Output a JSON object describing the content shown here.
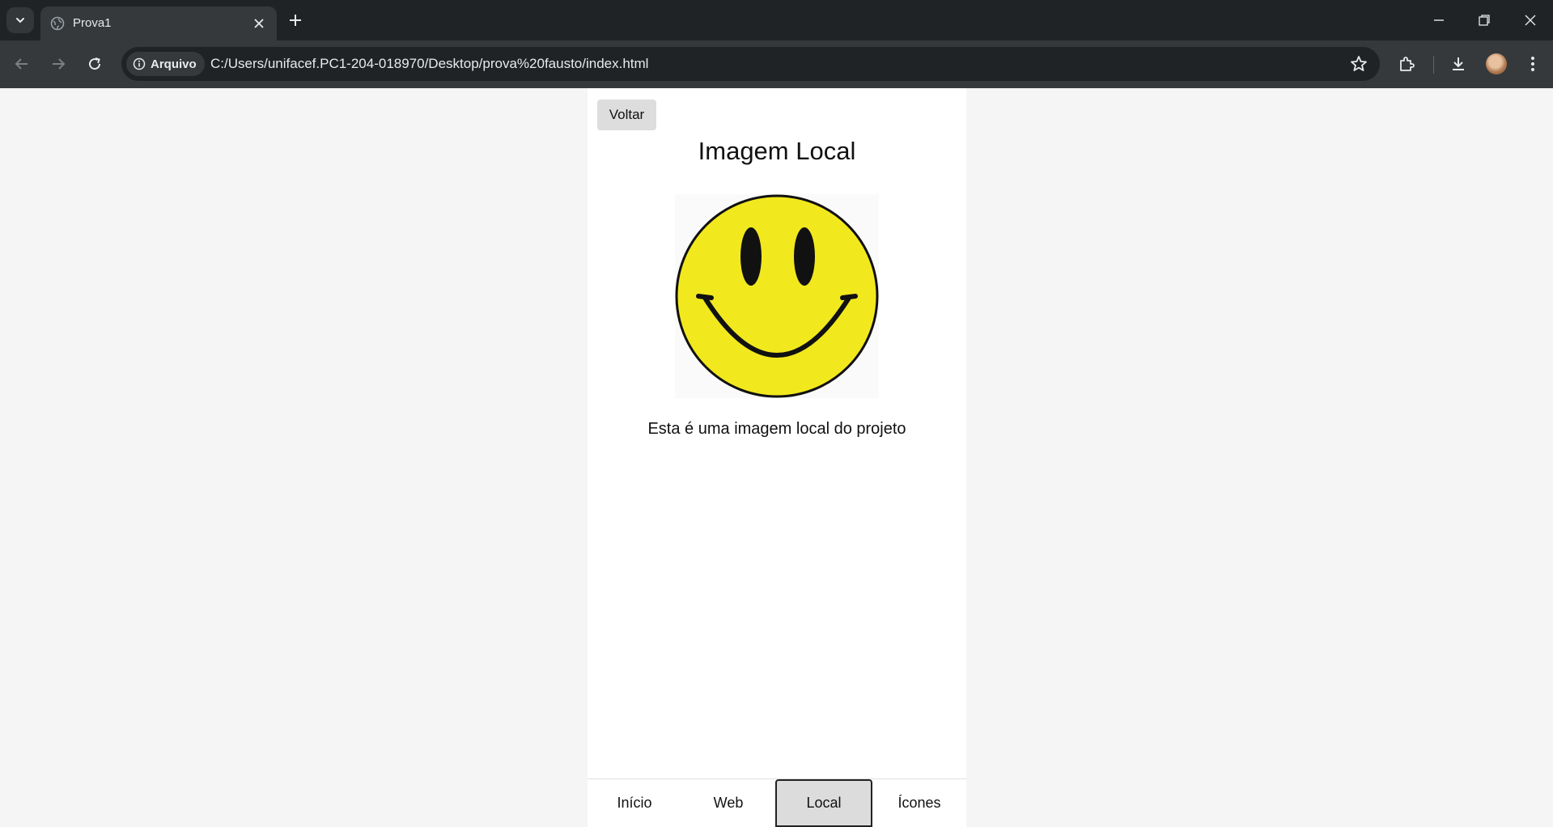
{
  "browser": {
    "tab_title": "Prova1",
    "security_label": "Arquivo",
    "url": "C:/Users/unifacef.PC1-204-018970/Desktop/prova%20fausto/index.html"
  },
  "page": {
    "back_label": "Voltar",
    "heading": "Imagem Local",
    "image_alt": "smiley face",
    "caption": "Esta é uma imagem local do projeto"
  },
  "bottom_nav": {
    "items": [
      {
        "label": "Início"
      },
      {
        "label": "Web"
      },
      {
        "label": "Local"
      },
      {
        "label": "Ícones"
      }
    ],
    "active": "Local"
  },
  "colors": {
    "chrome_dark": "#1f2326",
    "chrome_mid": "#35393c",
    "page_bg": "#f5f5f5",
    "smiley_yellow": "#f2e81e",
    "active_tab_bg": "#dcdcdc"
  }
}
